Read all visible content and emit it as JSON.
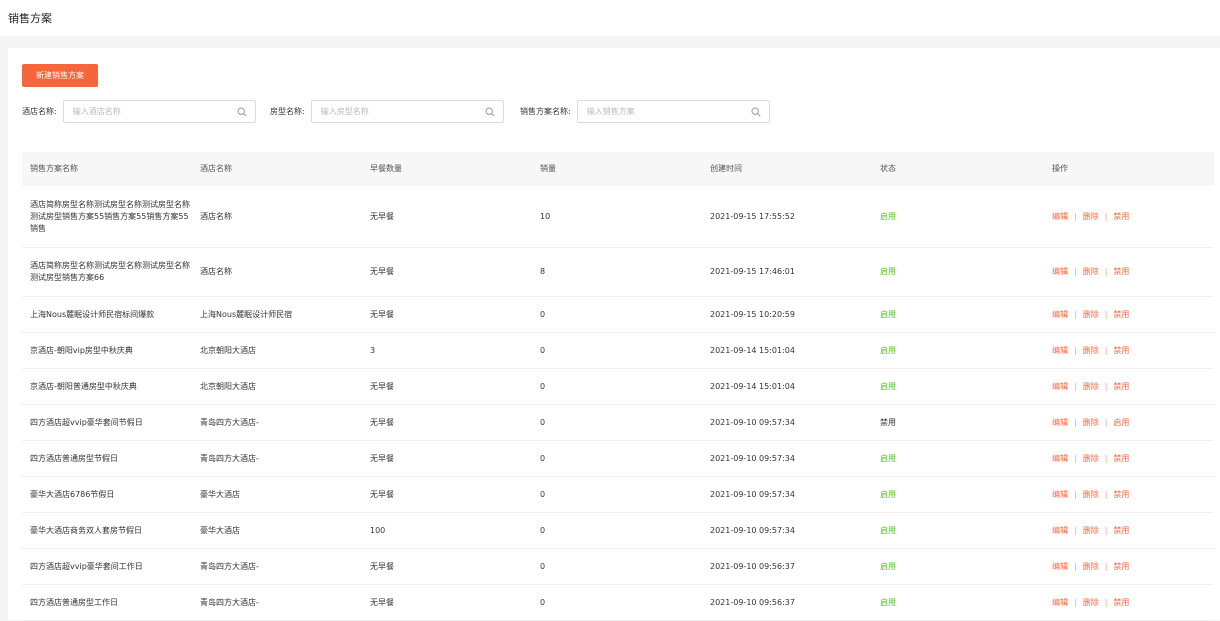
{
  "page": {
    "title": "销售方案"
  },
  "toolbar": {
    "new_label": "新建销售方案"
  },
  "filters": [
    {
      "label": "酒店名称:",
      "placeholder": "输入酒店名称"
    },
    {
      "label": "房型名称:",
      "placeholder": "输入房型名称"
    },
    {
      "label": "销售方案名称:",
      "placeholder": "输入销售方案"
    }
  ],
  "table": {
    "headers": [
      "销售方案名称",
      "酒店名称",
      "早餐数量",
      "销量",
      "创建时间",
      "状态",
      "操作"
    ],
    "rows": [
      {
        "name": "酒店简称房型名称测试房型名称测试房型名称测试房型销售方案55销售方案55销售方案55销售",
        "hotel": "酒店名称",
        "breakfast": "无早餐",
        "sales": "10",
        "created": "2021-09-15 17:55:52",
        "status": "启用",
        "ops": [
          "编辑",
          "删除",
          "禁用"
        ]
      },
      {
        "name": "酒店简称房型名称测试房型名称测试房型名称测试房型销售方案66",
        "hotel": "酒店名称",
        "breakfast": "无早餐",
        "sales": "8",
        "created": "2021-09-15 17:46:01",
        "status": "启用",
        "ops": [
          "编辑",
          "删除",
          "禁用"
        ]
      },
      {
        "name": "上海Nous麓眠设计师民宿标间爆款",
        "hotel": "上海Nous麓眠设计师民宿",
        "breakfast": "无早餐",
        "sales": "0",
        "created": "2021-09-15 10:20:59",
        "status": "启用",
        "ops": [
          "编辑",
          "删除",
          "禁用"
        ]
      },
      {
        "name": "京酒店-朝阳vip房型中秋庆典",
        "hotel": "北京朝阳大酒店",
        "breakfast": "3",
        "sales": "0",
        "created": "2021-09-14 15:01:04",
        "status": "启用",
        "ops": [
          "编辑",
          "删除",
          "禁用"
        ]
      },
      {
        "name": "京酒店-朝阳普通房型中秋庆典",
        "hotel": "北京朝阳大酒店",
        "breakfast": "无早餐",
        "sales": "0",
        "created": "2021-09-14 15:01:04",
        "status": "启用",
        "ops": [
          "编辑",
          "删除",
          "禁用"
        ]
      },
      {
        "name": "四方酒店超vvip豪华套间节假日",
        "hotel": "青岛四方大酒店-",
        "breakfast": "无早餐",
        "sales": "0",
        "created": "2021-09-10 09:57:34",
        "status": "禁用",
        "ops": [
          "编辑",
          "删除",
          "启用"
        ]
      },
      {
        "name": "四方酒店普通房型节假日",
        "hotel": "青岛四方大酒店-",
        "breakfast": "无早餐",
        "sales": "0",
        "created": "2021-09-10 09:57:34",
        "status": "启用",
        "ops": [
          "编辑",
          "删除",
          "禁用"
        ]
      },
      {
        "name": "豪华大酒店6786节假日",
        "hotel": "豪华大酒店",
        "breakfast": "无早餐",
        "sales": "0",
        "created": "2021-09-10 09:57:34",
        "status": "启用",
        "ops": [
          "编辑",
          "删除",
          "禁用"
        ]
      },
      {
        "name": "豪华大酒店商务双人套房节假日",
        "hotel": "豪华大酒店",
        "breakfast": "100",
        "sales": "0",
        "created": "2021-09-10 09:57:34",
        "status": "启用",
        "ops": [
          "编辑",
          "删除",
          "禁用"
        ]
      },
      {
        "name": "四方酒店超vvip豪华套间工作日",
        "hotel": "青岛四方大酒店-",
        "breakfast": "无早餐",
        "sales": "0",
        "created": "2021-09-10 09:56:37",
        "status": "启用",
        "ops": [
          "编辑",
          "删除",
          "禁用"
        ]
      },
      {
        "name": "四方酒店普通房型工作日",
        "hotel": "青岛四方大酒店-",
        "breakfast": "无早餐",
        "sales": "0",
        "created": "2021-09-10 09:56:37",
        "status": "启用",
        "ops": [
          "编辑",
          "删除",
          "禁用"
        ]
      }
    ]
  },
  "colors": {
    "accent": "#f5673a",
    "enabled": "#52c41a"
  }
}
